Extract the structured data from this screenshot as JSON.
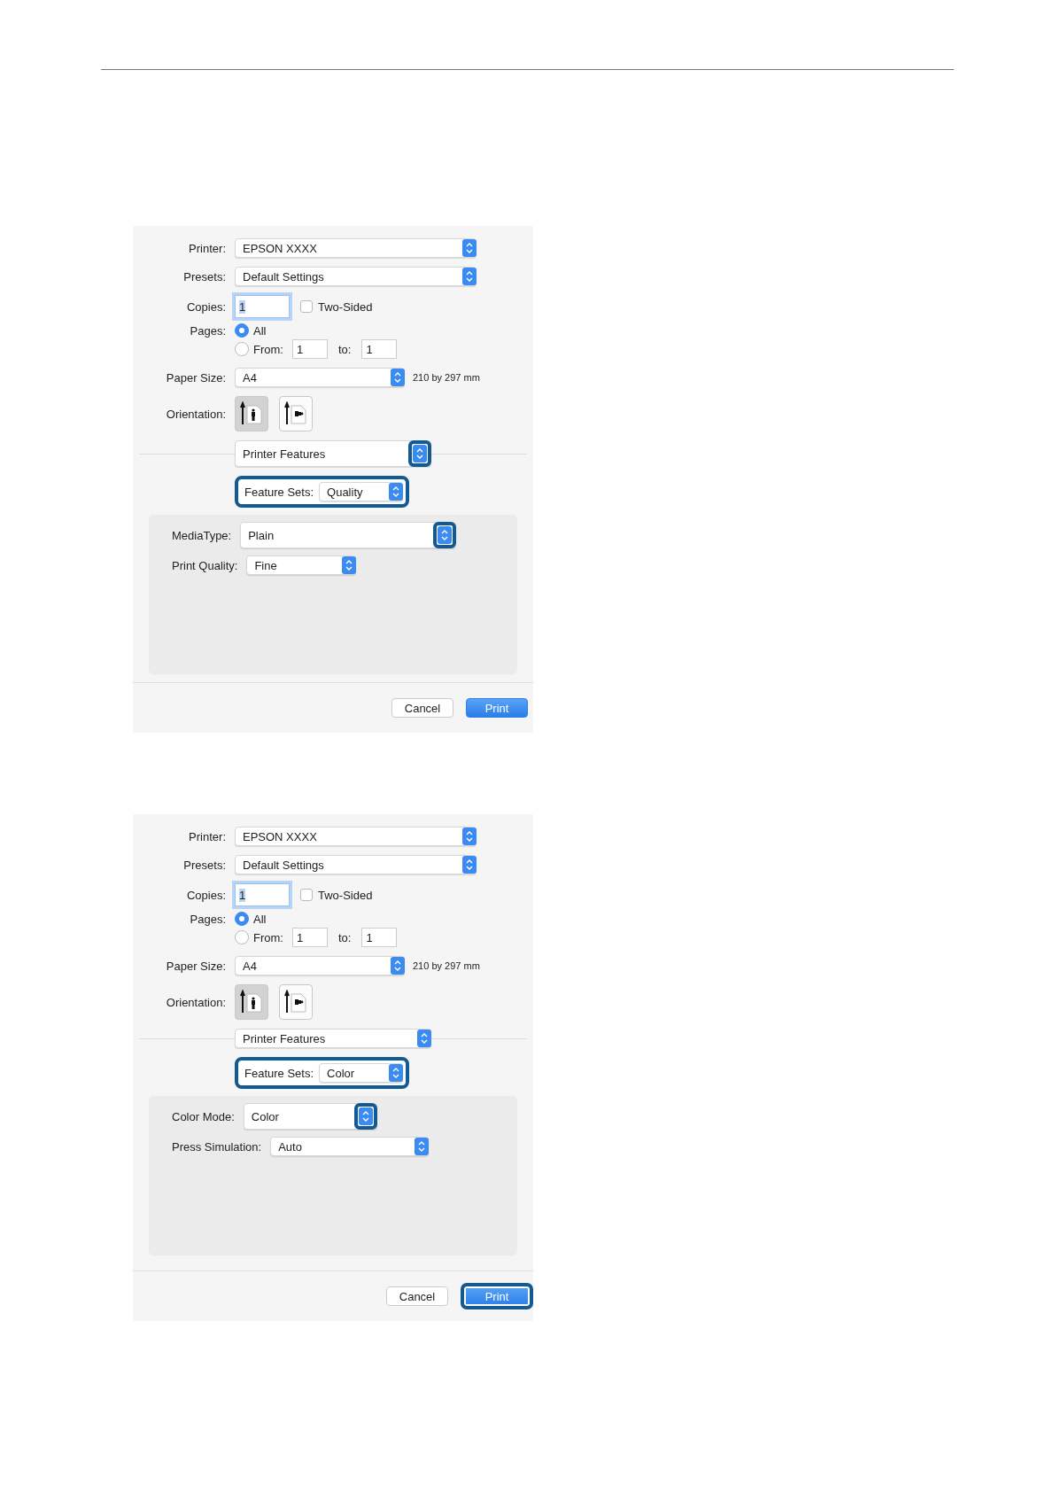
{
  "dialogs": [
    {
      "printer": {
        "label": "Printer:",
        "value": "EPSON XXXX"
      },
      "presets": {
        "label": "Presets:",
        "value": "Default Settings"
      },
      "copies": {
        "label": "Copies:",
        "value": "1"
      },
      "two_sided": {
        "label": "Two-Sided",
        "checked": false
      },
      "pages": {
        "label": "Pages:",
        "options": [
          {
            "label": "All",
            "selected": true
          },
          {
            "label": "From:",
            "selected": false
          }
        ],
        "from": "1",
        "to_label": "to:",
        "to": "1"
      },
      "paper_size": {
        "label": "Paper Size:",
        "value": "A4",
        "dimensions": "210 by 297 mm"
      },
      "orientation": {
        "label": "Orientation:",
        "options": [
          {
            "kind": "portrait",
            "selected": true
          },
          {
            "kind": "landscape",
            "selected": false
          }
        ]
      },
      "section": {
        "value": "Printer Features",
        "highlighted": true
      },
      "feature_sets": {
        "label": "Feature Sets:",
        "value": "Quality",
        "highlighted": true
      },
      "settings": [
        {
          "label": "MediaType:",
          "value": "Plain",
          "highlighted": true
        },
        {
          "label": "Print Quality:",
          "value": "Fine",
          "highlighted": false
        }
      ],
      "buttons": [
        {
          "label": "Cancel",
          "kind": "secondary",
          "highlighted": false
        },
        {
          "label": "Print",
          "kind": "primary",
          "highlighted": false
        }
      ]
    },
    {
      "printer": {
        "label": "Printer:",
        "value": "EPSON XXXX"
      },
      "presets": {
        "label": "Presets:",
        "value": "Default Settings"
      },
      "copies": {
        "label": "Copies:",
        "value": "1"
      },
      "two_sided": {
        "label": "Two-Sided",
        "checked": false
      },
      "pages": {
        "label": "Pages:",
        "options": [
          {
            "label": "All",
            "selected": true
          },
          {
            "label": "From:",
            "selected": false
          }
        ],
        "from": "1",
        "to_label": "to:",
        "to": "1"
      },
      "paper_size": {
        "label": "Paper Size:",
        "value": "A4",
        "dimensions": "210 by 297 mm"
      },
      "orientation": {
        "label": "Orientation:",
        "options": [
          {
            "kind": "portrait",
            "selected": true
          },
          {
            "kind": "landscape",
            "selected": false
          }
        ]
      },
      "section": {
        "value": "Printer Features",
        "highlighted": false
      },
      "feature_sets": {
        "label": "Feature Sets:",
        "value": "Color",
        "highlighted": true
      },
      "settings": [
        {
          "label": "Color Mode:",
          "value": "Color",
          "highlighted": true
        },
        {
          "label": "Press Simulation:",
          "value": "Auto",
          "highlighted": false
        }
      ],
      "buttons": [
        {
          "label": "Cancel",
          "kind": "secondary",
          "highlighted": false
        },
        {
          "label": "Print",
          "kind": "primary",
          "highlighted": true
        }
      ]
    }
  ]
}
